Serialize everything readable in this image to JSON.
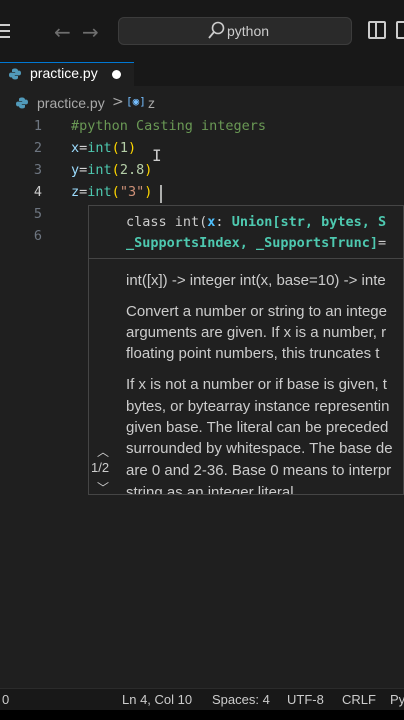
{
  "titlebar": {
    "search_text": "python"
  },
  "tab": {
    "filename": "practice.py"
  },
  "breadcrumb": {
    "file": "practice.py",
    "separator": ">",
    "symbol_icon": "[◉]",
    "symbol": "z"
  },
  "editor": {
    "lines": [
      {
        "number": "1",
        "text": "#python Casting integers"
      },
      {
        "number": "2",
        "text": "x=int(1)"
      },
      {
        "number": "3",
        "text": "y=int(2.8)"
      },
      {
        "number": "4",
        "text": "z=int(\"3\")"
      },
      {
        "number": "5",
        "text": ""
      },
      {
        "number": "6",
        "text": ""
      }
    ],
    "active_line": 4
  },
  "hover": {
    "signature_line1_kw": "class int(",
    "signature_line1_param": "x",
    "signature_line1_colon": ": ",
    "signature_line1_type": "Union[str, bytes, S",
    "signature_line2": "_SupportsIndex, _SupportsTrunc]",
    "signature_line2_tail": "=",
    "doc_lines": [
      "int([x]) -> integer int(x, base=10) -> inte",
      "Convert a number or string to an intege",
      "arguments are given. If x is a number, r",
      "floating point numbers, this truncates t",
      "If x is not a number or if base is given, t",
      "bytes, or bytearray instance representin",
      "given base. The literal can be preceded",
      "surrounded by whitespace. The base de",
      "are 0 and 2-36. Base 0 means to interpr",
      "string as an integer literal"
    ],
    "overload_counter": "1/2"
  },
  "statusbar": {
    "left": "0",
    "position": "Ln 4, Col 10",
    "indent": "Spaces: 4",
    "encoding": "UTF-8",
    "eol": "CRLF",
    "language": "Py"
  },
  "colors": {
    "background": "#1f1f1f",
    "comment": "#6a9955",
    "variable": "#9cdcfe",
    "function": "#4ec9b0",
    "bracket": "#ffd700",
    "number": "#b5cea8",
    "string": "#ce9178",
    "accent": "#0078d4"
  }
}
